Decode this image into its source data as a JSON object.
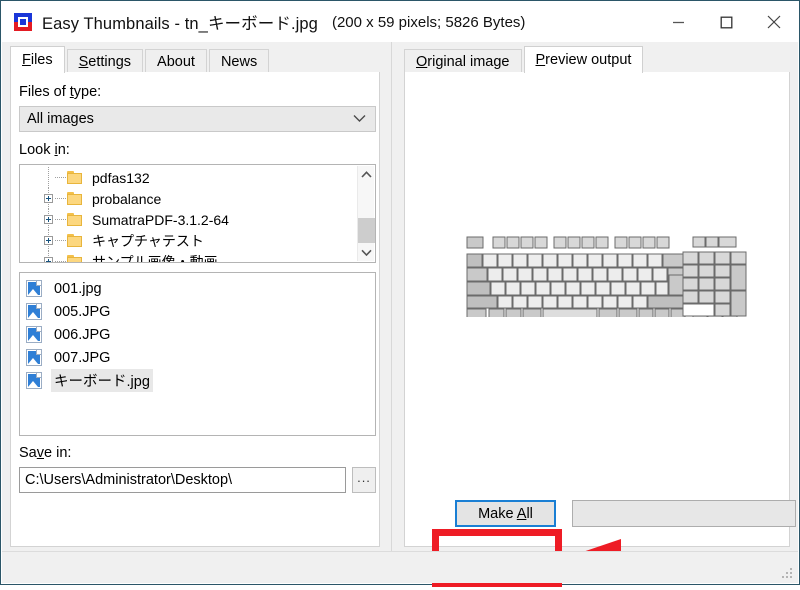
{
  "window": {
    "app_name": "Easy Thumbnails",
    "title": "Easy Thumbnails - tn_キーボード.jpg",
    "file_meta": "(200 x 59 pixels;  5826 Bytes)",
    "icon": "app-icon",
    "controls": {
      "minimize": "minimize-icon",
      "maximize": "maximize-icon",
      "close": "close-icon"
    }
  },
  "left": {
    "tabs": [
      {
        "label": "Files",
        "accel": "F",
        "active": true
      },
      {
        "label": "Settings",
        "accel": "S",
        "active": false
      },
      {
        "label": "About",
        "accel": "",
        "active": false
      },
      {
        "label": "News",
        "accel": "",
        "active": false
      }
    ],
    "files_of_type": {
      "label_pre": "Files of ",
      "label_accel": "t",
      "label_post": "ype:",
      "value": "All images",
      "options": [
        "All images"
      ]
    },
    "look_in": {
      "label_pre": "Look ",
      "label_accel": "i",
      "label_post": "n:",
      "items": [
        {
          "name": "pdfas132",
          "expandable": false
        },
        {
          "name": "probalance",
          "expandable": true
        },
        {
          "name": "SumatraPDF-3.1.2-64",
          "expandable": true
        },
        {
          "name": "キャプチャテスト",
          "expandable": true
        },
        {
          "name": "サンプル画像・動画",
          "expandable": true
        }
      ]
    },
    "file_list": [
      {
        "name": "001.jpg",
        "selected": false
      },
      {
        "name": "005.JPG",
        "selected": false
      },
      {
        "name": "006.JPG",
        "selected": false
      },
      {
        "name": "007.JPG",
        "selected": false
      },
      {
        "name": "キーボード.jpg",
        "selected": true
      }
    ],
    "save_in": {
      "label_pre": "Sa",
      "label_accel": "v",
      "label_post": "e in:",
      "value": "C:\\Users\\Administrator\\Desktop\\",
      "browse_label": "..."
    }
  },
  "right": {
    "tabs": [
      {
        "label_pre": "",
        "accel": "O",
        "label_post": "riginal image",
        "active": false
      },
      {
        "label_pre": "",
        "accel": "P",
        "label_post": "review output",
        "active": true
      }
    ],
    "preview": {
      "alt": "keyboard-thumbnail"
    },
    "buttons": [
      {
        "pre": "Make ",
        "accel": "A",
        "post": "ll",
        "focused": true
      },
      {
        "pre": "",
        "accel": "",
        "post": "",
        "focused": false
      }
    ]
  },
  "annotations": {
    "highlight_color": "#ee1c25",
    "arrow_color": "#ee1c25",
    "target": "make-all-button"
  }
}
